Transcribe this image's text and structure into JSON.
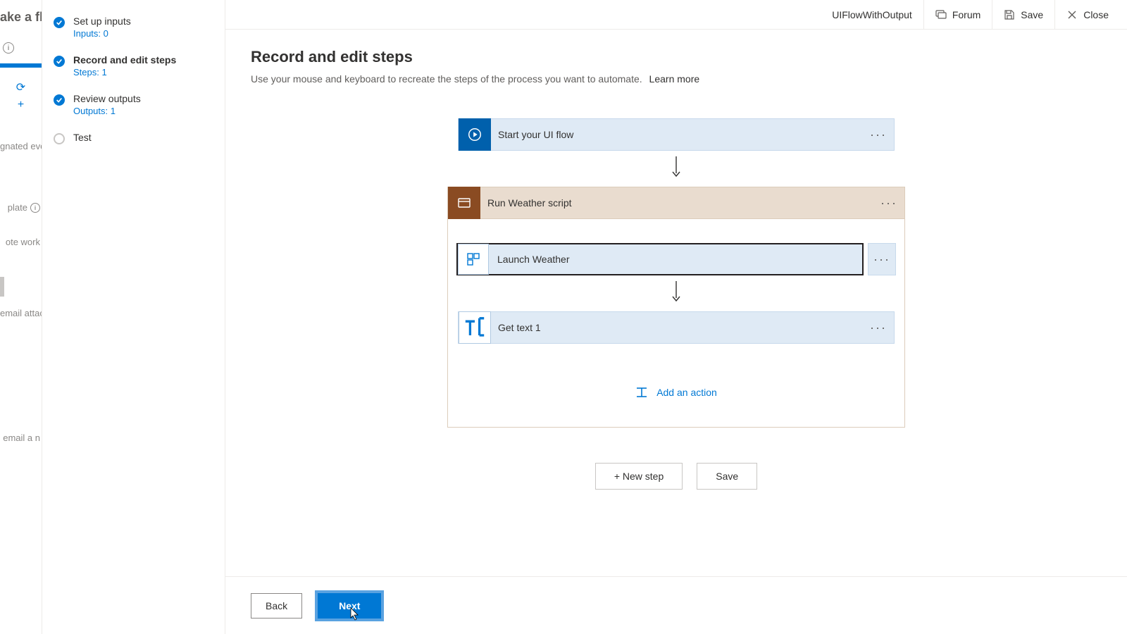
{
  "bg": {
    "title": "ake a fl",
    "items": [
      "gnated even",
      "plate",
      "ote work",
      "email attac",
      "email a n"
    ]
  },
  "header": {
    "flow_name": "UIFlowWithOutput",
    "forum": "Forum",
    "save": "Save",
    "close": "Close"
  },
  "wizard": {
    "steps": [
      {
        "title": "Set up inputs",
        "sub": "Inputs: 0"
      },
      {
        "title": "Record and edit steps",
        "sub": "Steps: 1"
      },
      {
        "title": "Review outputs",
        "sub": "Outputs: 1"
      },
      {
        "title": "Test",
        "sub": ""
      }
    ]
  },
  "page": {
    "title": "Record and edit steps",
    "subtitle": "Use your mouse and keyboard to recreate the steps of the process you want to automate.",
    "learn_more": "Learn more"
  },
  "flow": {
    "start": "Start your UI flow",
    "script": "Run Weather script",
    "inner": [
      "Launch Weather",
      "Get text 1"
    ],
    "add_action": "Add an action"
  },
  "buttons": {
    "new_step": "+ New step",
    "save": "Save",
    "back": "Back",
    "next": "Next"
  }
}
